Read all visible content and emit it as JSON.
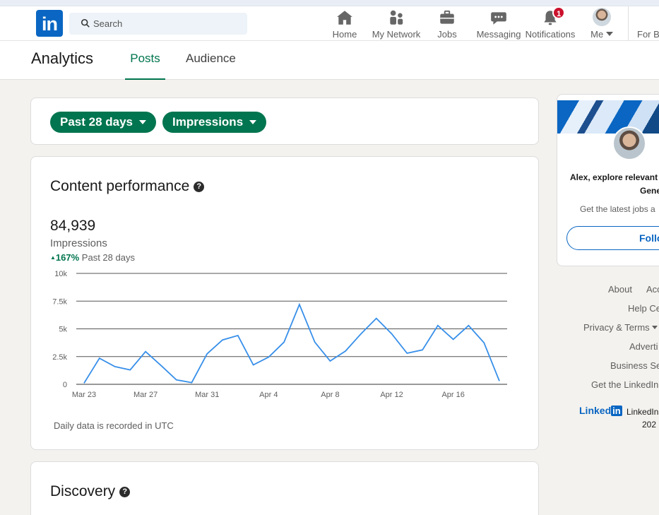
{
  "nav": {
    "logo_text": "in",
    "search_placeholder": "Search",
    "items": [
      {
        "label": "Home",
        "icon": "home-icon"
      },
      {
        "label": "My Network",
        "icon": "network-icon"
      },
      {
        "label": "Jobs",
        "icon": "briefcase-icon"
      },
      {
        "label": "Messaging",
        "icon": "messaging-icon"
      },
      {
        "label": "Notifications",
        "icon": "bell-icon",
        "badge": "1"
      },
      {
        "label": "Me",
        "icon": "avatar"
      },
      {
        "label": "For B"
      }
    ]
  },
  "analytics": {
    "title": "Analytics",
    "tabs": [
      "Posts",
      "Audience"
    ],
    "active_tab": "Posts"
  },
  "filters": {
    "range": "Past 28 days",
    "metric": "Impressions"
  },
  "content_performance": {
    "title": "Content performance",
    "help": "?",
    "total": "84,939",
    "metric_label": "Impressions",
    "delta_arrow": "▲",
    "delta_pct": "167%",
    "delta_period": "Past 28 days",
    "note": "Daily data is recorded in UTC"
  },
  "chart_data": {
    "type": "line",
    "x": [
      "Mar 23",
      "Mar 24",
      "Mar 25",
      "Mar 26",
      "Mar 27",
      "Mar 28",
      "Mar 29",
      "Mar 30",
      "Mar 31",
      "Apr 1",
      "Apr 2",
      "Apr 3",
      "Apr 4",
      "Apr 5",
      "Apr 6",
      "Apr 7",
      "Apr 8",
      "Apr 9",
      "Apr 10",
      "Apr 11",
      "Apr 12",
      "Apr 13",
      "Apr 14",
      "Apr 15",
      "Apr 16",
      "Apr 17",
      "Apr 18",
      "Apr 19"
    ],
    "values": [
      100,
      2350,
      1600,
      1300,
      2950,
      1700,
      400,
      150,
      2750,
      4000,
      4400,
      1750,
      2450,
      3800,
      7200,
      3800,
      2100,
      3000,
      4550,
      5950,
      4550,
      2800,
      3100,
      5300,
      4050,
      5300,
      3750,
      300
    ],
    "x_tick_labels": [
      "Mar 23",
      "Mar 27",
      "Mar 31",
      "Apr 4",
      "Apr 8",
      "Apr 12",
      "Apr 16"
    ],
    "y_tick_labels": [
      "0",
      "2.5k",
      "5k",
      "7.5k",
      "10k"
    ],
    "ylim": [
      0,
      10000
    ],
    "grid": true,
    "color": "#378fe9"
  },
  "discovery": {
    "title": "Discovery",
    "help": "?"
  },
  "right_rail": {
    "headline_line1": "Alex, explore relevant",
    "headline_line2": "Gene",
    "subtext": "Get the latest jobs a",
    "follow_label": "Follo",
    "footer_links": [
      "About",
      "Acc",
      "Help Ce",
      "Privacy & Terms",
      "Adverti",
      "Business Se",
      "Get the LinkedIn"
    ],
    "footer_brand": "Linked",
    "footer_brand_box": "in",
    "footer_corp": "LinkedIn",
    "footer_year": "202"
  },
  "colors": {
    "brand": "#0a66c2",
    "accent_green": "#01754f",
    "notification": "#cb112d"
  }
}
